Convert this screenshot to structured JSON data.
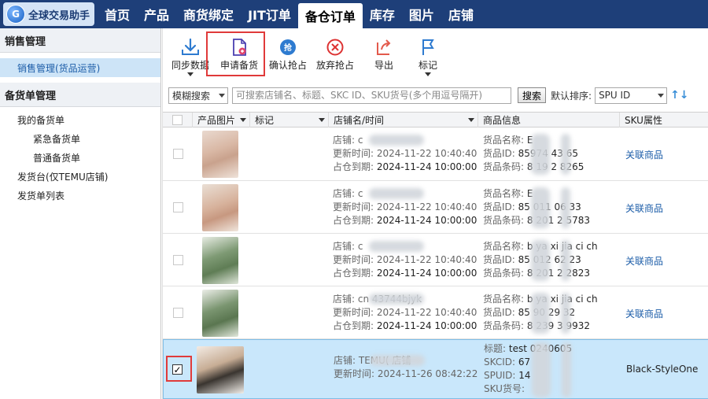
{
  "app": {
    "title": "全球交易助手",
    "logo_letter": "G"
  },
  "nav": [
    "首页",
    "产品",
    "商货绑定",
    "JIT订单",
    "备仓订单",
    "库存",
    "图片",
    "店铺"
  ],
  "nav_active": 4,
  "sidebar": {
    "sections": [
      {
        "title": "销售管理",
        "items": [
          {
            "label": "销售管理(货品运营)",
            "selected": true
          }
        ]
      },
      {
        "title": "备货单管理",
        "items": [
          {
            "label": "我的备货单",
            "level": 1
          },
          {
            "label": "紧急备货单",
            "level": 2
          },
          {
            "label": "普通备货单",
            "level": 2
          },
          {
            "label": "发货台(仅TEMU店铺)",
            "level": 1
          },
          {
            "label": "发货单列表",
            "level": 1
          }
        ]
      }
    ]
  },
  "toolbar": [
    {
      "id": "sync",
      "label": "同步数据",
      "icon": "download-icon",
      "dropdown": true
    },
    {
      "id": "apply",
      "label": "申请备货",
      "icon": "document-plus-icon",
      "highlighted": true
    },
    {
      "id": "grab",
      "label": "确认抢占",
      "icon": "grab-icon"
    },
    {
      "id": "abandon",
      "label": "放弃抢占",
      "icon": "cancel-circle-icon"
    },
    {
      "id": "export",
      "label": "导出",
      "icon": "export-icon"
    },
    {
      "id": "mark",
      "label": "标记",
      "icon": "flag-icon",
      "dropdown": true
    }
  ],
  "filter": {
    "mode": "模糊搜索",
    "search_placeholder": "可搜索店铺名、标题、SKC ID、SKU货号(多个用逗号隔开)",
    "search_button": "搜索",
    "sort_label": "默认排序:",
    "sort_value": "SPU ID"
  },
  "columns": [
    "产品图片",
    "标记",
    "店铺名/时间",
    "商品信息",
    "SKU属性"
  ],
  "rows": [
    {
      "shop": "店铺: c",
      "update_time": "2024-11-22 10:40:40",
      "occupy_time": "2024-11-24 10:00:00",
      "info": [
        [
          "货品名称:",
          "E"
        ],
        [
          "货品ID:",
          "85974  43  65"
        ],
        [
          "货品条码:",
          "8  19  2  8265"
        ]
      ],
      "sku": "关联商品",
      "checked": false
    },
    {
      "shop": "店铺: c",
      "update_time": "2024-11-22 10:40:40",
      "occupy_time": "2024-11-24 10:00:00",
      "info": [
        [
          "货品名称:",
          "E"
        ],
        [
          "货品ID:",
          "85  011  06  33"
        ],
        [
          "货品条码:",
          "8  201  2  5783"
        ]
      ],
      "sku": "关联商品",
      "checked": false
    },
    {
      "shop": "店铺: c",
      "update_time": "2024-11-22 10:40:40",
      "occupy_time": "2024-11-24 10:00:00",
      "info": [
        [
          "货品名称:",
          "b  ya   xi  jia ci ch"
        ],
        [
          "货品ID:",
          "85  012  62  23"
        ],
        [
          "货品条码:",
          "8  201  2  2823"
        ]
      ],
      "sku": "关联商品",
      "checked": false
    },
    {
      "shop": "店铺: cn  43744bjyk",
      "update_time": "2024-11-22 10:40:40",
      "occupy_time": "2024-11-24 10:00:00",
      "info": [
        [
          "货品名称:",
          "b  ya   xi  jia ci ch"
        ],
        [
          "货品ID:",
          "85  90  29  32"
        ],
        [
          "货品条码:",
          "8  239  3  9932"
        ]
      ],
      "sku": "关联商品",
      "checked": false
    },
    {
      "shop": "店铺: TEMU(    店铺",
      "update_time": "2024-11-26 08:42:22",
      "occupy_time": "",
      "info": [
        [
          "标题:",
          "test    0240605"
        ],
        [
          "SKCID:",
          "67"
        ],
        [
          "SPUID:",
          "14"
        ],
        [
          "SKU货号:",
          ""
        ]
      ],
      "sku": "Black-StyleOne",
      "checked": true
    }
  ],
  "labels": {
    "shop_prefix": "店铺:",
    "update": "更新时间:",
    "occupy": "占仓到期:"
  },
  "colors": {
    "nav_bg": "#1e3f79",
    "link": "#1c5da8",
    "highlight": "#e03a3a",
    "selected_row": "#c9e7fb"
  }
}
